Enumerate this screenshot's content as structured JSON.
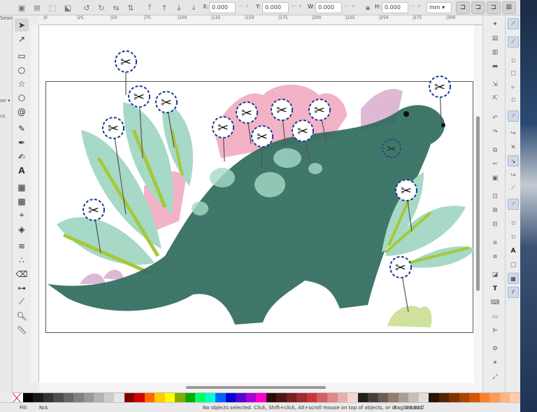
{
  "controls": {
    "x_label": "X:",
    "x_value": "0.000",
    "y_label": "Y:",
    "y_value": "0.000",
    "w_label": "W:",
    "w_value": "0.000",
    "h_label": "H:",
    "h_value": "0.000",
    "unit": "mm ▾",
    "spin_glyph": "—+"
  },
  "left_edge": {
    "text1": "Search",
    "text2": "on ▾",
    "text3": "cs"
  },
  "ruler": {
    "h_ticks": [
      "|0",
      "|25",
      "|50",
      "|75",
      "|100",
      "|125",
      "|150",
      "|175",
      "|200",
      "|225",
      "|250",
      "|275",
      "|300"
    ]
  },
  "status": {
    "fill_label": "Fill:",
    "fill_value": "N/A",
    "message": "No objects selected. Click, Shift+click, Alt+scroll mouse on top of objects, or drag around",
    "x_label": "X:",
    "x_value": "323.92",
    "z_value": "Z"
  },
  "colors": {
    "accent_blue": "#1f3a93",
    "stitch_green": "#2e6f61",
    "leaf_mint": "#9ad3bf",
    "leaf_lime": "#a6c83a",
    "spike_pink": "#f0a2bc"
  },
  "icons": {
    "cut_markers": "scissors-icon"
  }
}
